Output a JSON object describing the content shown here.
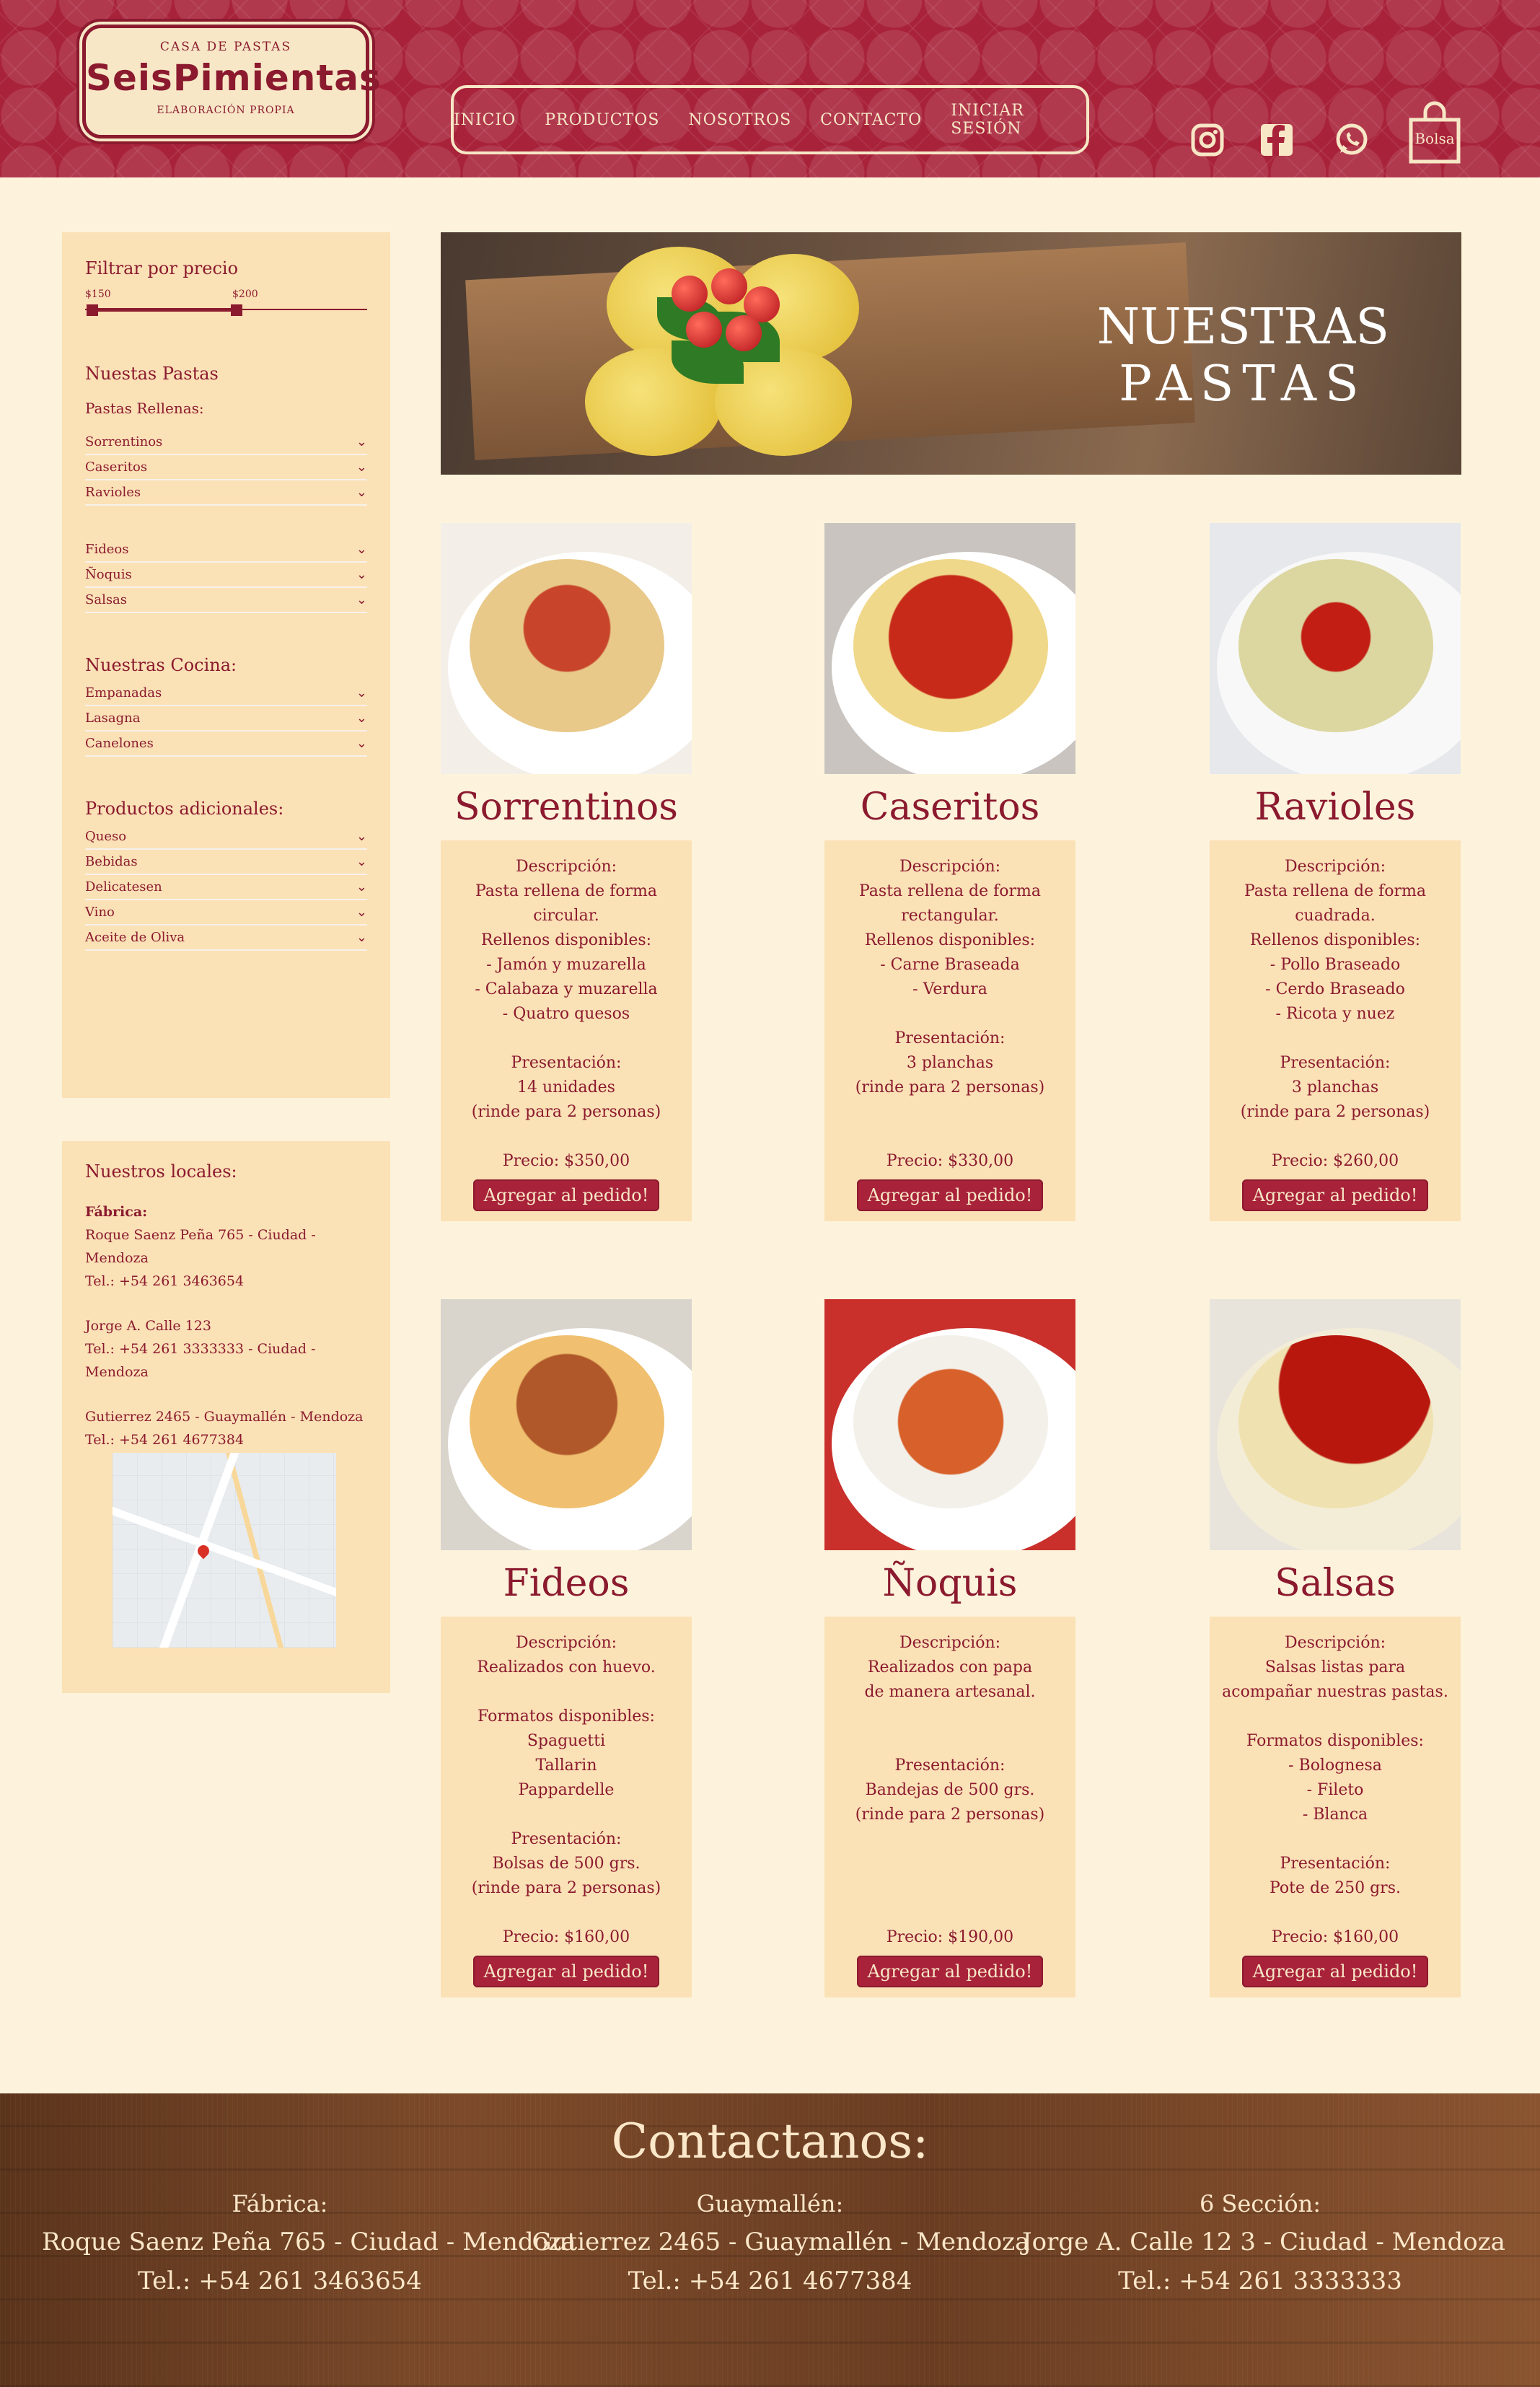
{
  "brand": {
    "tagline_top": "CASA DE PASTAS",
    "name": "SeisPimientas",
    "tagline_bottom": "ELABORACIÓN PROPIA"
  },
  "nav": {
    "items": [
      "INICIO",
      "PRODUCTOS",
      "NOSOTROS",
      "CONTACTO",
      "INICIAR SESIÓN"
    ]
  },
  "header_icons": {
    "instagram": "instagram-icon",
    "facebook": "facebook-icon",
    "whatsapp": "whatsapp-icon",
    "bag_label": "Bolsa"
  },
  "filter": {
    "title": "Filtrar por precio",
    "min_label": "$150",
    "max_label": "$200",
    "range": [
      150,
      200
    ]
  },
  "sidebar": {
    "pastas_title": "Nuestas Pastas",
    "rellenas_title": "Pastas Rellenas:",
    "rellenas": [
      "Sorrentinos",
      "Caseritos",
      "Ravioles"
    ],
    "otras": [
      "Fideos",
      "Ñoquis",
      "Salsas"
    ],
    "cocina_title": "Nuestras Cocina:",
    "cocina": [
      "Empanadas",
      "Lasagna",
      "Canelones"
    ],
    "adicionales_title": "Productos adicionales:",
    "adicionales": [
      "Queso",
      "Bebidas",
      "Delicatesen",
      "Vino",
      "Aceite de Oliva"
    ]
  },
  "locales": {
    "title": "Nuestros locales:",
    "lines": [
      "Fábrica:",
      "Roque Saenz Peña 765 - Ciudad - Mendoza",
      "Tel.: +54 261 3463654",
      "",
      "Jorge A. Calle 123",
      "Tel.: +54 261 3333333 - Ciudad - Mendoza",
      "",
      "Gutierrez 2465 - Guaymallén - Mendoza",
      "Tel.: +54 261 4677384"
    ]
  },
  "hero": {
    "line1": "NUESTRAS",
    "line2": "PASTAS"
  },
  "products": [
    {
      "name": "Sorrentinos",
      "lines": [
        "Descripción:",
        "Pasta rellena de forma",
        "circular.",
        "Rellenos disponibles:",
        "- Jamón y muzarella",
        "- Calabaza y muzarella",
        "- Quatro quesos",
        "",
        "Presentación:",
        "14 unidades",
        "(rinde para 2 personas)",
        "",
        "Precio: $350,00"
      ],
      "button": "Agregar al pedido!"
    },
    {
      "name": "Caseritos",
      "lines": [
        "Descripción:",
        "Pasta rellena de forma",
        "rectangular.",
        "Rellenos disponibles:",
        "- Carne Braseada",
        "- Verdura",
        "",
        "Presentación:",
        "3 planchas",
        "(rinde para 2 personas)",
        "",
        "",
        "Precio: $330,00"
      ],
      "button": "Agregar al pedido!"
    },
    {
      "name": "Ravioles",
      "lines": [
        "Descripción:",
        "Pasta rellena de forma",
        "cuadrada.",
        "Rellenos disponibles:",
        "- Pollo Braseado",
        "- Cerdo Braseado",
        "- Ricota y nuez",
        "",
        "Presentación:",
        "3 planchas",
        "(rinde para 2 personas)",
        "",
        "Precio: $260,00"
      ],
      "button": "Agregar al pedido!"
    },
    {
      "name": "Fideos",
      "lines": [
        "Descripción:",
        "Realizados con huevo.",
        "",
        "Formatos disponibles:",
        "Spaguetti",
        "Tallarin",
        "Pappardelle",
        "",
        "Presentación:",
        "Bolsas de 500 grs.",
        "(rinde para 2 personas)",
        "",
        "Precio: $160,00"
      ],
      "button": "Agregar al pedido!"
    },
    {
      "name": "Ñoquis",
      "lines": [
        "Descripción:",
        "Realizados con papa",
        "de manera artesanal.",
        "",
        "",
        "Presentación:",
        "Bandejas de 500 grs.",
        "(rinde para 2 personas)",
        "",
        "",
        "",
        "",
        "Precio: $190,00"
      ],
      "button": "Agregar al pedido!"
    },
    {
      "name": "Salsas",
      "lines": [
        "Descripción:",
        "Salsas listas para",
        "acompañar nuestras pastas.",
        "",
        "Formatos disponibles:",
        "- Bolognesa",
        "- Fileto",
        "- Blanca",
        "",
        "Presentación:",
        "Pote de 250 grs.",
        "",
        "Precio: $160,00"
      ],
      "button": "Agregar al pedido!"
    }
  ],
  "footer": {
    "title": "Contactanos:",
    "columns": [
      {
        "title": "Fábrica:",
        "address": "Roque Saenz Peña 765 - Ciudad - Mendoza",
        "phone": "Tel.: +54 261 3463654"
      },
      {
        "title": "Guaymallén:",
        "address": "Gutierrez 2465 - Guaymallén - Mendoza",
        "phone": "Tel.: +54 261 4677384"
      },
      {
        "title": "6 Sección:",
        "address": "Jorge A. Calle 12 3 - Ciudad - Mendoza",
        "phone": "Tel.: +54 261 3333333"
      }
    ]
  },
  "colors": {
    "brand": "#a8223a",
    "text": "#8b1a2f",
    "panel": "#fbe1b6",
    "page": "#fdf3dc"
  }
}
